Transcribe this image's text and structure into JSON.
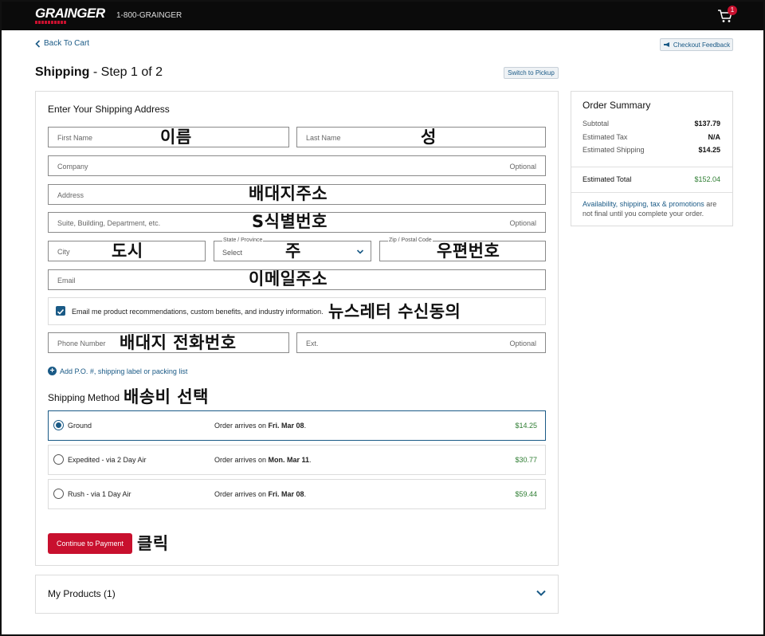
{
  "header": {
    "logo": "GRAINGER",
    "phone": "1-800-GRAINGER",
    "cart_count": "1"
  },
  "nav": {
    "back": "Back To Cart",
    "feedback": "Checkout Feedback"
  },
  "page": {
    "title_bold": "Shipping",
    "title_rest": " - Step 1 of 2",
    "switch_pickup": "Switch to Pickup"
  },
  "form": {
    "section_title": "Enter Your Shipping Address",
    "first_name": "First Name",
    "last_name": "Last Name",
    "company": "Company",
    "optional": "Optional",
    "address": "Address",
    "suite": "Suite, Building, Department, etc.",
    "city": "City",
    "state_label": "State / Province",
    "state_value": "Select",
    "zip_label": "Zip / Postal Code",
    "email": "Email",
    "optin": "Email me product recommendations, custom benefits, and industry information.",
    "phone": "Phone Number",
    "ext": "Ext.",
    "add_po": "Add P.O. #, shipping label or packing list"
  },
  "annotations": {
    "first_name": "이름",
    "last_name": "성",
    "address": "배대지주소",
    "suite": "S식별번호",
    "city": "도시",
    "state": "주",
    "zip": "우편번호",
    "email": "이메일주소",
    "optin": "뉴스레터 수신동의",
    "phone": "배대지 전화번호",
    "method": "배송비 선택",
    "click": "클릭"
  },
  "shipping": {
    "title": "Shipping Method",
    "options": [
      {
        "name": "Ground",
        "arrive_prefix": "Order arrives on ",
        "date": "Fri. Mar 08",
        "price": "$14.25",
        "selected": true
      },
      {
        "name": "Expedited - via 2 Day Air",
        "arrive_prefix": "Order arrives on ",
        "date": "Mon. Mar 11",
        "price": "$30.77",
        "selected": false
      },
      {
        "name": "Rush - via 1 Day Air",
        "arrive_prefix": "Order arrives on ",
        "date": "Fri. Mar 08",
        "price": "$59.44",
        "selected": false
      }
    ],
    "continue": "Continue to Payment"
  },
  "products": {
    "title": "My Products (1)"
  },
  "summary": {
    "title": "Order Summary",
    "subtotal_label": "Subtotal",
    "subtotal": "$137.79",
    "tax_label": "Estimated Tax",
    "tax": "N/A",
    "shipping_label": "Estimated Shipping",
    "shipping": "$14.25",
    "total_label": "Estimated Total",
    "total": "$152.04",
    "note_link": "Availability, shipping, tax & promotions",
    "note_rest": " are not final until you complete your order."
  },
  "colors": {
    "brand_red": "#c8102e",
    "link_blue": "#1a5a86",
    "price_green": "#2e7d32"
  }
}
